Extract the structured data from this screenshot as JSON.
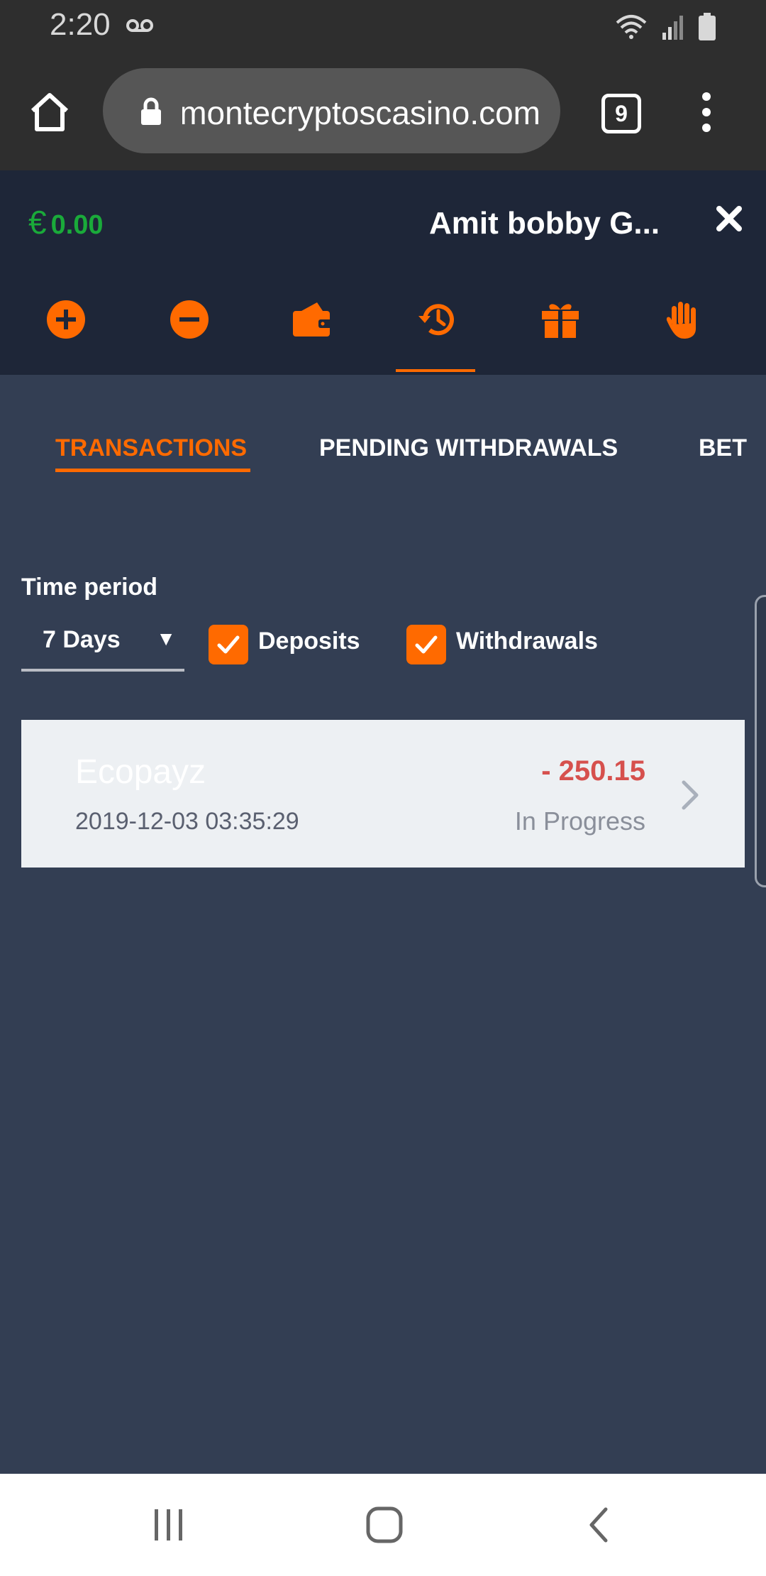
{
  "status_bar": {
    "time": "2:20"
  },
  "browser": {
    "url": "montecryptoscasino.com",
    "tab_count": "9"
  },
  "account": {
    "currency": "€",
    "balance": "0.00",
    "username": "Amit bobby G...",
    "nav_icons": [
      "deposit-icon",
      "withdraw-icon",
      "wallet-icon",
      "history-icon",
      "gift-icon",
      "hand-icon"
    ],
    "active_nav": "history-icon",
    "accent_color": "#ff6a00"
  },
  "tabs": [
    {
      "label": "TRANSACTIONS",
      "active": true
    },
    {
      "label": "PENDING WITHDRAWALS",
      "active": false
    },
    {
      "label": "BET",
      "active": false
    }
  ],
  "filters": {
    "time_period_label": "Time period",
    "time_period_value": "7 Days",
    "deposits_label": "Deposits",
    "deposits_checked": true,
    "withdrawals_label": "Withdrawals",
    "withdrawals_checked": true
  },
  "transactions": [
    {
      "method": "Ecopayz",
      "date": "2019-12-03 03:35:29",
      "amount": "- 250.15",
      "status": "In Progress"
    }
  ]
}
